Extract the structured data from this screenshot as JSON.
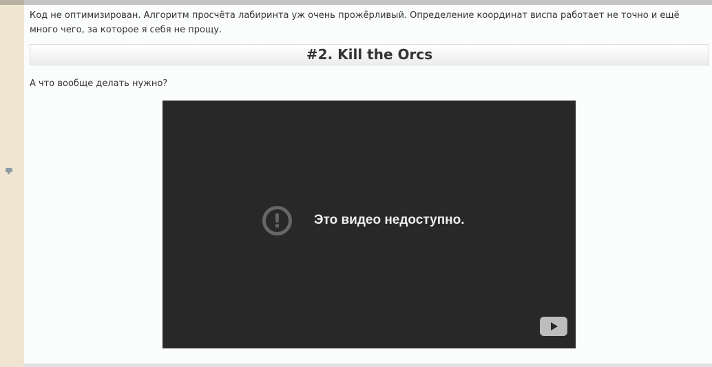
{
  "post": {
    "paragraph1": "Код не оптимизирован. Алгоритм просчёта лабиринта уж очень прожёрливый. Определение координат виспа работает не точно и ещё много чего, за которое я себя не прощу.",
    "heading": "#2. Kill the Orcs",
    "paragraph2": "А что вообще делать нужно?"
  },
  "video": {
    "message": "Это видео недоступно.",
    "warning_symbol": "!"
  }
}
